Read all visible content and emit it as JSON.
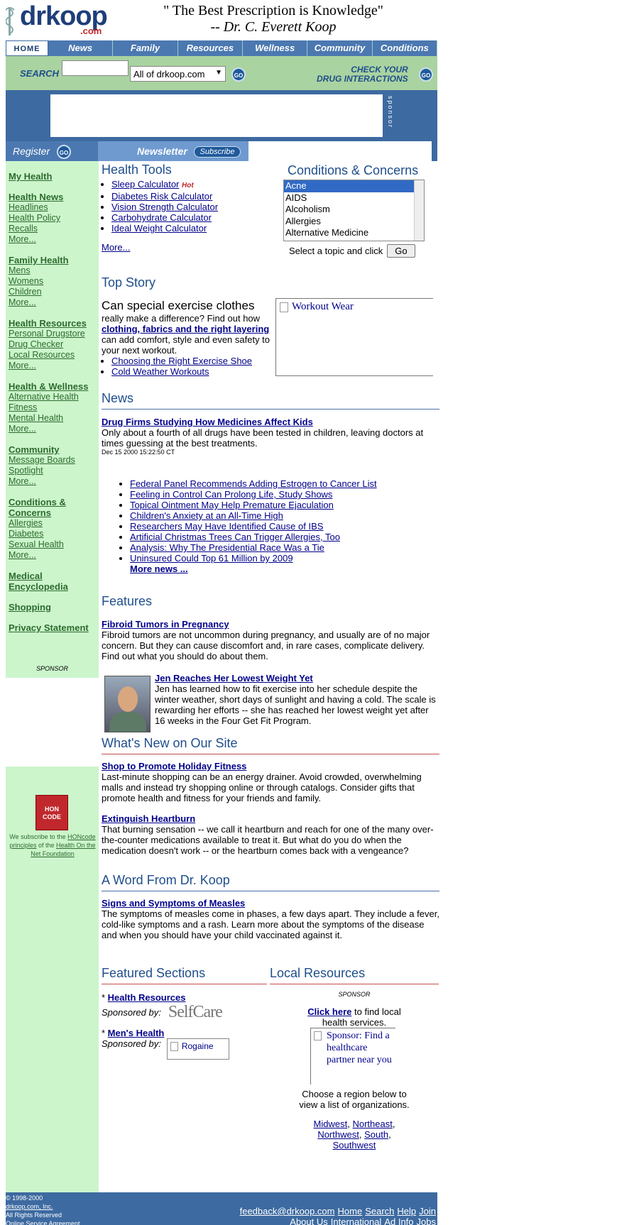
{
  "header": {
    "logo_text": "drkoop",
    "logo_sub": ".com",
    "quote": "\" The Best Prescription is Knowledge\"",
    "quote_author": "-- Dr. C. Everett Koop"
  },
  "nav": {
    "tabs": [
      "HOME",
      "News",
      "Family",
      "Resources",
      "Wellness",
      "Community",
      "Conditions"
    ]
  },
  "search": {
    "label": "SEARCH",
    "input_value": "",
    "scope": "All of drkoop.com",
    "go": "GO",
    "drug_line1": "CHECK YOUR",
    "drug_line2": "DRUG INTERACTIONS"
  },
  "banner": {
    "sponsor": "sponsor"
  },
  "regbar": {
    "register": "Register",
    "newsletter": "Newsletter",
    "subscribe": "Subscribe"
  },
  "sidebar": {
    "sections": [
      {
        "title": "My Health",
        "items": []
      },
      {
        "title": "Health News",
        "items": [
          "Headlines",
          "Health Policy",
          "Recalls",
          "More..."
        ]
      },
      {
        "title": "Family Health",
        "items": [
          "Mens",
          "Womens",
          "Children",
          "More..."
        ]
      },
      {
        "title": "Health Resources",
        "items": [
          "Personal Drugstore",
          "Drug Checker",
          "Local Resources",
          "More..."
        ]
      },
      {
        "title": "Health & Wellness",
        "items": [
          "Alternative Health",
          "Fitness",
          "Mental Health",
          "More..."
        ]
      },
      {
        "title": "Community",
        "items": [
          "Message Boards",
          "Spotlight",
          "More..."
        ]
      },
      {
        "title": "Conditions & Concerns",
        "items": [
          "Allergies",
          "Diabetes",
          "Sexual Health",
          "More..."
        ]
      },
      {
        "title": "Medical Encyclopedia",
        "items": []
      },
      {
        "title": "Shopping",
        "items": []
      },
      {
        "title": "Privacy Statement",
        "items": []
      }
    ],
    "sponsor": "SPONSOR",
    "hon_badge": "HON CODE",
    "hon_text_1": "We subscribe to the ",
    "hon_link_1": "HONcode principles",
    "hon_text_2": " of the ",
    "hon_link_2": "Health On the Net Foundation"
  },
  "health_tools": {
    "title": "Health Tools",
    "hot": "Hot",
    "items": [
      "Sleep Calculator",
      "Diabetes Risk Calculator",
      "Vision Strength Calculator",
      "Carbohydrate Calculator",
      "Ideal Weight Calculator"
    ],
    "more": "More..."
  },
  "conditions": {
    "title": "Conditions & Concerns",
    "options": [
      "Acne",
      "AIDS",
      "Alcoholism",
      "Allergies",
      "Alternative Medicine"
    ],
    "selected": "Acne",
    "instruction": "Select a topic and click",
    "go": "Go"
  },
  "top_story": {
    "title": "Top Story",
    "headline": "Can special exercise clothes",
    "lead": "really make a difference? Find out how ",
    "link": "clothing, fabrics and the right layering",
    "tail": " can add comfort, style and even safety to your next workout.",
    "bullets": [
      "Choosing the Right Exercise Shoe",
      "Cold Weather Workouts"
    ],
    "image_alt": "Workout Wear"
  },
  "news": {
    "title": "News",
    "lead_headline": "Drug Firms Studying How Medicines Affect Kids",
    "lead_text": "Only about a fourth of all drugs have been tested in children, leaving doctors at times guessing at the best treatments.",
    "lead_date": "Dec 15 2000 15:22:50 CT",
    "items": [
      "Federal Panel Recommends Adding Estrogen to Cancer List",
      "Feeling in Control Can Prolong Life, Study Shows",
      "Topical Ointment May Help Premature Ejaculation",
      "Children's Anxiety at an All-Time High",
      "Researchers May Have Identified Cause of IBS",
      "Artificial Christmas Trees Can Trigger Allergies, Too",
      "Analysis: Why The Presidential Race Was a Tie",
      "Uninsured Could Top 61 Million by 2009"
    ],
    "more": "More news ..."
  },
  "features": {
    "title": "Features",
    "f1_headline": "Fibroid Tumors in Pregnancy",
    "f1_text": "Fibroid tumors are not uncommon during pregnancy, and usually are of no major concern. But they can cause discomfort and, in rare cases, complicate delivery. Find out what you should do about them.",
    "f2_headline": "Jen Reaches Her Lowest Weight Yet",
    "f2_text": "Jen has learned how to fit exercise into her schedule despite the winter weather, short days of sunlight and having a cold. The scale is rewarding her efforts -- she has reached her lowest weight yet after 16 weeks in the Four Get Fit Program."
  },
  "whats_new": {
    "title": "What's New on Our Site",
    "w1_headline": "Shop to Promote Holiday Fitness",
    "w1_text": "Last-minute shopping can be an energy drainer. Avoid crowded, overwhelming malls and instead try shopping online or through catalogs. Consider gifts that promote health and fitness for your friends and family.",
    "w2_headline": "Extinguish Heartburn",
    "w2_text": "That burning sensation -- we call it heartburn and reach for one of the many over-the-counter medications available to treat it. But what do you do when the medication doesn't work -- or the heartburn comes back with a vengeance?"
  },
  "koop_word": {
    "title": "A Word From Dr. Koop",
    "headline": "Signs and Symptoms of Measles",
    "text": "The symptoms of measles come in phases, a few days apart. They include a fever, cold-like symptoms and a rash. Learn more about the symptoms of the disease and when you should have your child vaccinated against it."
  },
  "featured_sections": {
    "title": "Featured Sections",
    "s1": "Health Resources",
    "s2": "Men's Health",
    "sponsored_by": "Sponsored by:",
    "selfcare": "SelfCare",
    "rogaine": "Rogaine"
  },
  "local_resources": {
    "title": "Local Resources",
    "sponsor": "SPONSOR",
    "click_here": "Click here",
    "click_tail": " to find local health services.",
    "ad_alt": "Sponsor: Find a healthcare partner near you",
    "choose": "Choose a region below to view a list of organizations.",
    "regions": [
      "Midwest",
      "Northeast",
      "Northwest",
      "South",
      "Southwest"
    ]
  },
  "footer": {
    "copyright": "© 1998-2000",
    "company": "drkoop.com, Inc.",
    "rights": "All Rights Reserved",
    "agreement": "Online Service Agreement",
    "links_row1": [
      "feedback@drkoop.com",
      "Home",
      "Search",
      "Help",
      "Join"
    ],
    "links_row2": [
      "About Us",
      "International",
      "Ad Info",
      "Jobs"
    ]
  }
}
